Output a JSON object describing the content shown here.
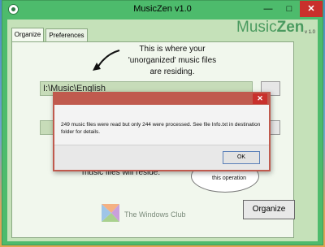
{
  "window": {
    "title": "MusicZen v1.0",
    "minimize": "—",
    "maximize": "□",
    "close": "✕"
  },
  "tabs": [
    {
      "label": "Organize"
    },
    {
      "label": "Preferences"
    }
  ],
  "brand": {
    "music": "Music",
    "zen": "Zen",
    "version": "v 1.0"
  },
  "hint": {
    "text": "This is where your 'unorganized' music files are residing."
  },
  "source_path": {
    "value": "I:\\Music\\English"
  },
  "lower_hint": {
    "text": "music files will reside."
  },
  "bubble": {
    "text": "this operation"
  },
  "watermark": {
    "text": "The Windows Club"
  },
  "organize_button": {
    "label": "Organize"
  },
  "dialog": {
    "close": "✕",
    "message": "249 music files were read but only 244 were processed. See file Info.txt in destination folder for details.",
    "ok_label": "OK"
  },
  "colors": {
    "accent": "#4dbb6c",
    "panel": "#c5e1b9",
    "dialog_border": "#c05a4e",
    "close_red": "#c9302c"
  }
}
